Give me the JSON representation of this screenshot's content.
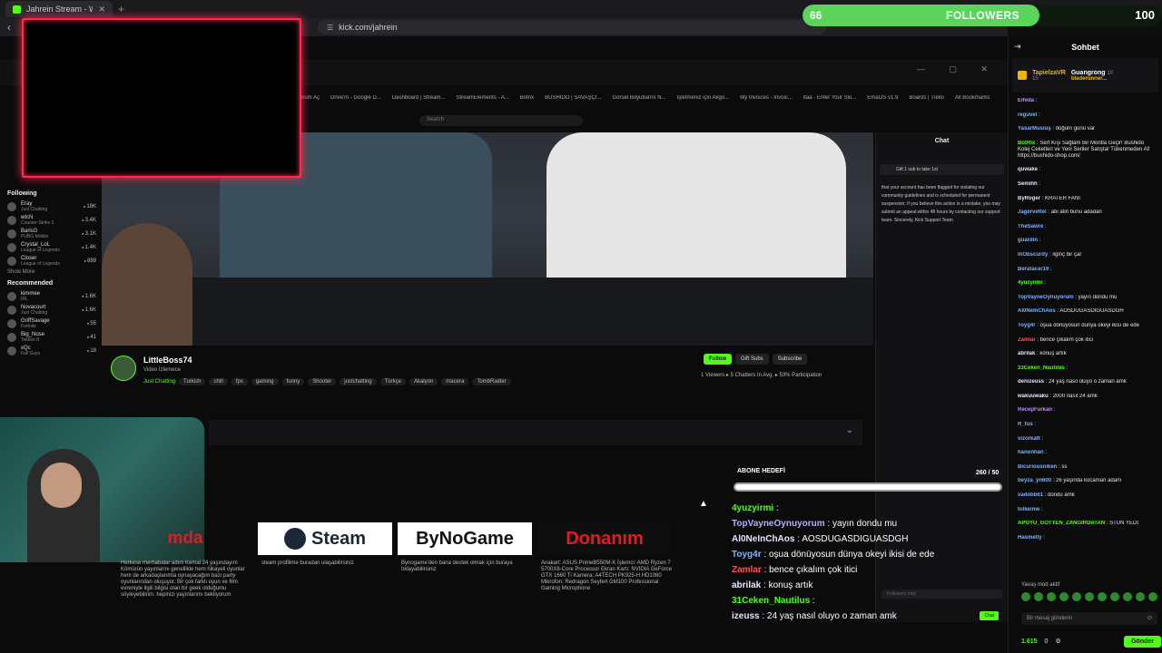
{
  "browser": {
    "tab_title": "Jahrein Stream - Watch Live o...",
    "new_tab": "+",
    "url": "kick.com/jahrein"
  },
  "followers": {
    "current": "66",
    "label": "FOLLOWERS",
    "goal": "100",
    "progress_percent": 66,
    "bar_color": "#5bd45b"
  },
  "inner_bookmarks": [
    "urum Aç",
    "Drive'm - Google D...",
    "Dashboard | Stream...",
    "StreamElements - A...",
    "Botrix",
    "BUSHIDO | SAVAŞÇI...",
    "Görsel Boyutlarını N...",
    "İşletmeniz için Akgo...",
    "My Invoices - Invoic...",
    "itaa - Enter Your Slo...",
    "EmaOS v1.9",
    "Boards | Trello",
    "All Bookmarks"
  ],
  "inner_search": "Search",
  "side_nav": {
    "following_title": "Following",
    "following": [
      {
        "name": "Eray",
        "cat": "Just Chatting",
        "viewers": "18K"
      },
      {
        "name": "wtcN",
        "cat": "Counter-Strike 2",
        "viewers": "3.4K"
      },
      {
        "name": "BarisG",
        "cat": "PUBG Mobile",
        "viewers": "3.1K"
      },
      {
        "name": "Crystal_LoL",
        "cat": "League of Legends",
        "viewers": "1.4K"
      },
      {
        "name": "Closer",
        "cat": "League of Legends",
        "viewers": "889"
      }
    ],
    "show_more": "Show More",
    "recommended_title": "Recommended",
    "recommended": [
      {
        "name": "kimmee",
        "cat": "IRL",
        "viewers": "1.6K"
      },
      {
        "name": "Novacourt",
        "cat": "Just Chatting",
        "viewers": "1.6K"
      },
      {
        "name": "GriffSavage",
        "cat": "Fortnite",
        "viewers": "55"
      },
      {
        "name": "Big_Nose",
        "cat": "Tekken 8",
        "viewers": "41"
      },
      {
        "name": "xQc",
        "cat": "Fall Guys",
        "viewers": "18"
      }
    ]
  },
  "streamer": {
    "name": "LittleBoss74",
    "subtitle": "Video İzlemece",
    "category": "Just Chatting",
    "tags": [
      "Turkish",
      "chill",
      "fps",
      "gaming",
      "funny",
      "Shooter",
      "justchatting",
      "Türkçe",
      "Akalyon",
      "macera",
      "TombRaider"
    ],
    "buttons": {
      "follow": "Follow",
      "gift": "Gift Subs",
      "subscribe": "Subscribe"
    },
    "stats": "1 Viewers  ▸ 5 Chatters In Avg.  ▸ 53% Participation"
  },
  "panels": [
    {
      "label": "mda",
      "desc": "Herkese merhabalar adım Kemal 24 yaşındayım Kömürün yayınlarını genellikle hem hikayeli oyunlar hem de arkadaşlarımla oynayacağım bazı party oyunlarından oluşuyor. Bir çok farklı oyun ve film evreniyle ilgili bilgisi olan bir geek olduğumu söyleyebilirim. hepinizi yayınlarımı bekliyorum"
    },
    {
      "label": "Steam",
      "desc": "steam profilime buradan ulaşabilirsiniz"
    },
    {
      "label": "ByNoGame",
      "desc": "Bynogame'den bana destek olmak için buraya tıklayabilirsiniz"
    },
    {
      "label": "Donanım",
      "desc": "Anakart: ASUS PrimeB550M-K İşlemci: AMD Ryzen 7 5700X8-Core Processor Ekran Kartı: NVIDIA GeForce GTX 1660 Ti Kamera: A4TECH PK925-H HD1080 Mikrofon: Redragon Seyfert GM100 Professional Gaming Microphone"
    }
  ],
  "abone": {
    "title": "ABONE HEDEFİ",
    "count": "260 / 50"
  },
  "overlay_chat": [
    {
      "user": "4yuzyirmi",
      "text": " :",
      "color": "#53fc18"
    },
    {
      "user": "TopVayneOynuyorum",
      "text": " : yayın dondu mu",
      "color": "#b0b0ff"
    },
    {
      "user": "Al0NeInChAos",
      "text": " : AOSDUGASDIGUASDGH",
      "color": "#e5e5ff"
    },
    {
      "user": "Toyg4r",
      "text": " : oşua dönüyosun dünya okeyi ikisi de ede",
      "color": "#7ab3ff"
    },
    {
      "user": "Zamlar",
      "text": " : bence çıkalım çok itici",
      "color": "#ff5252"
    },
    {
      "user": "abrilak",
      "text": " : konuş artık",
      "color": "#e5e5ff"
    },
    {
      "user": "31Ceken_Nautilus",
      "text": " :",
      "color": "#53fc18"
    },
    {
      "user": "izeuss",
      "text": " : 24 yaş nasıl oluyo o zaman amk",
      "color": "#e5e5ff"
    }
  ],
  "inner_chat": {
    "title": "Chat",
    "gift": "Gift 1 sub to take 1st",
    "text": "that your account has been flagged for violating our community guidelines and is scheduled for permanent suspension; If you believe this action is a mistake, you may submit an appeal within 48 hours by contacting our support team. Sincerely, Kick Support Team",
    "input": "Followers only",
    "send": "Chat"
  },
  "chat": {
    "title": "Sohbet",
    "pinned": {
      "user1": "TapielzaVR",
      "user1_count": "15",
      "user2": "Guangrong",
      "user2_count": "10",
      "user3": "bladerunner..."
    },
    "messages": [
      {
        "user": "Elfeda",
        "text": ":",
        "color": "#c78bff"
      },
      {
        "user": "reguvel",
        "text": ":",
        "color": "#7ab3ff"
      },
      {
        "user": "YasarMusluş",
        "text": ": doğum günü var",
        "color": "#7ab3ff"
      },
      {
        "user": "BotRix",
        "text": ": Sert Kışı Sağlam Bir Montla Geçir! Bushido Kolej Ceketleri ve Yeni Seriler Satışta! Tükenmeden Al! https://bushido-shop.com/",
        "color": "#53fc18",
        "wrap": true
      },
      {
        "user": "quwake",
        "text": ":",
        "color": "#e5e5ff"
      },
      {
        "user": "Semihh",
        "text": ":",
        "color": "#e5e5ff"
      },
      {
        "user": "ByRoger",
        "text": ": KRATER FANI",
        "color": "#e5e5ff"
      },
      {
        "user": "Jagervettel",
        "text": ": abi atin bunu adadan",
        "color": "#7ab3ff"
      },
      {
        "user": "TheSawre",
        "text": ":",
        "color": "#7ab3ff"
      },
      {
        "user": "guardin",
        "text": ":",
        "color": "#7ab3ff"
      },
      {
        "user": "InObscurity",
        "text": ": ilginç bir çar",
        "color": "#7ab3ff"
      },
      {
        "user": "Beratacar19",
        "text": ":",
        "color": "#7ab3ff"
      },
      {
        "user": "4yuzyirmi",
        "text": ":",
        "color": "#53fc18"
      },
      {
        "user": "TopVayneOynuyorum",
        "text": ": yayın dondu mu",
        "color": "#7ab3ff"
      },
      {
        "user": "Al0NeInChAos",
        "text": ": AOSDUGASDIGUASDGH",
        "color": "#7ab3ff"
      },
      {
        "user": "Toyg4r",
        "text": ": oşua dönüyosun dünya okeyi ikisi de ede",
        "color": "#7ab3ff",
        "wrap": true
      },
      {
        "user": "Zamlar",
        "text": ": bence çıkalım çok itici",
        "color": "#ff5252"
      },
      {
        "user": "abrilak",
        "text": ": konuş artık",
        "color": "#e5e5ff"
      },
      {
        "user": "31Ceken_Nautilus",
        "text": ":",
        "color": "#53fc18"
      },
      {
        "user": "denizeuss",
        "text": ": 24 yaş nasıl oluyo o zaman amk",
        "color": "#e5e5ff"
      },
      {
        "user": "wakuuwaku",
        "text": ": 2000 nasıl 24 amk",
        "color": "#e5e5ff"
      },
      {
        "user": "RecepFurkan",
        "text": ":",
        "color": "#c78bff"
      },
      {
        "user": "R_fus",
        "text": ":",
        "color": "#7ab3ff"
      },
      {
        "user": "vizorkaft",
        "text": ":",
        "color": "#7ab3ff"
      },
      {
        "user": "hanonhan",
        "text": ":",
        "color": "#7ab3ff"
      },
      {
        "user": "Bicuriousniken",
        "text": ": ss",
        "color": "#7ab3ff"
      },
      {
        "user": "beyza_yn600",
        "text": ": 26 yaşında kocaman adam",
        "color": "#7ab3ff"
      },
      {
        "user": "vadobb61",
        "text": ": dondu amk",
        "color": "#7ab3ff"
      },
      {
        "user": "tolkeinie",
        "text": ":",
        "color": "#7ab3ff"
      },
      {
        "user": "APOYU_GOTTEN_ZANGIRDATAN",
        "text": ": STUN YEDİ",
        "color": "#53fc18",
        "wrap": true
      },
      {
        "user": "Hasmetly",
        "text": ":",
        "color": "#7ab3ff"
      }
    ],
    "slow_mode": "Yavaş mod aktif",
    "input_placeholder": "Bir mesaj gönderin",
    "points": "1.615",
    "count": "0",
    "send": "Gönder"
  }
}
